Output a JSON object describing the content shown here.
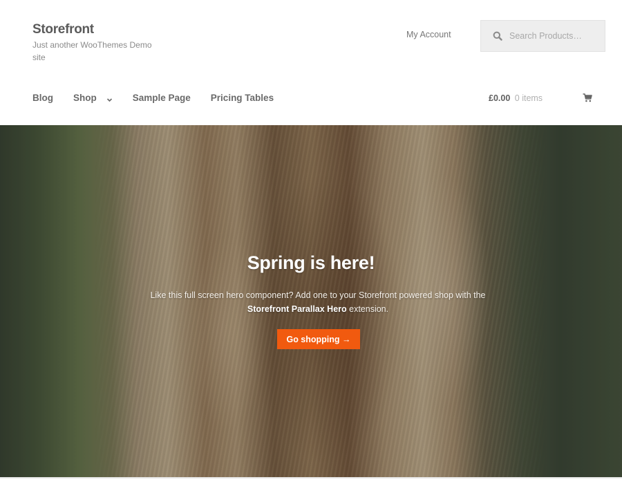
{
  "header": {
    "site_title": "Storefront",
    "site_description": "Just another WooThemes Demo site",
    "my_account_label": "My Account",
    "search": {
      "placeholder": "Search Products…",
      "value": "",
      "icon": "search-icon"
    }
  },
  "nav": {
    "items": [
      {
        "label": "Blog",
        "has_dropdown": false
      },
      {
        "label": "Shop",
        "has_dropdown": true
      },
      {
        "label": "Sample Page",
        "has_dropdown": false
      },
      {
        "label": "Pricing Tables",
        "has_dropdown": false
      }
    ]
  },
  "cart": {
    "amount": "£0.00",
    "count_label": "0 items",
    "icon": "cart-icon"
  },
  "hero": {
    "title": "Spring is here!",
    "text_before": "Like this full screen hero component? Add one to your Storefront powered shop with the ",
    "text_bold": "Storefront Parallax Hero",
    "text_after": " extension.",
    "button_label": "Go shopping →",
    "button_color": "#f15a0f"
  }
}
